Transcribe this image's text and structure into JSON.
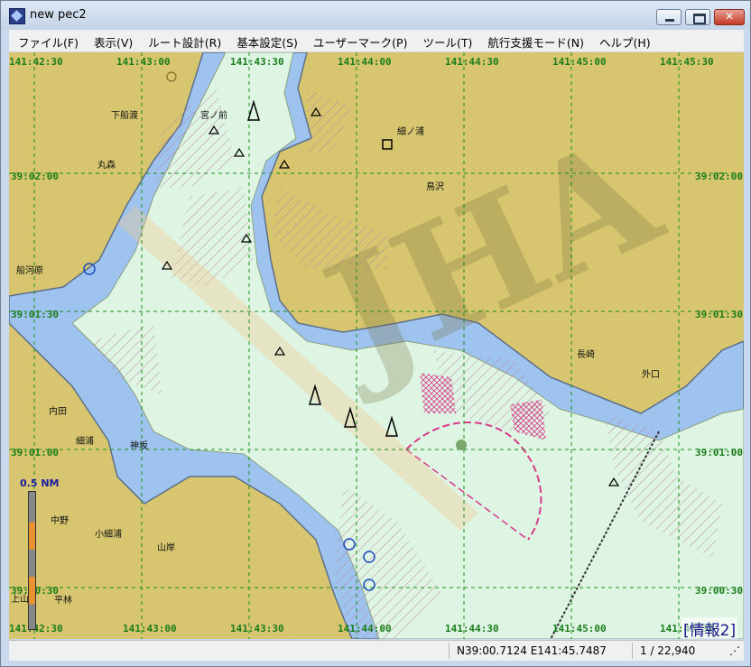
{
  "window": {
    "title": "new pec2"
  },
  "menu": [
    {
      "id": "file",
      "label": "ファイル(F)"
    },
    {
      "id": "view",
      "label": "表示(V)"
    },
    {
      "id": "route",
      "label": "ルート設計(R)"
    },
    {
      "id": "settings",
      "label": "基本設定(S)"
    },
    {
      "id": "usermark",
      "label": "ユーザーマーク(P)"
    },
    {
      "id": "tools",
      "label": "ツール(T)"
    },
    {
      "id": "navmode",
      "label": "航行支援モード(N)"
    },
    {
      "id": "help",
      "label": "ヘルプ(H)"
    }
  ],
  "map": {
    "lon_top": [
      "141:42:30",
      "141:43:00",
      "141:43:30",
      "141:44:00",
      "141:44:30",
      "141:45:00",
      "141:45:30"
    ],
    "lon_bottom": [
      "141:42:30",
      "141:43:00",
      "141:43:30",
      "141:44:00",
      "141:44:30",
      "141:45:00",
      "141:45:30"
    ],
    "lat_left": [
      "39:02:00",
      "39:01:30",
      "39:01:00",
      "39:00:30"
    ],
    "lat_right": [
      "39:02:00",
      "39:01:30",
      "39:01:00",
      "39:00:30"
    ],
    "places": {
      "shimofunawatari": "下船渡",
      "miyanomae": "宮ノ前",
      "hosonoura": "細ノ浦",
      "marumori": "丸森",
      "torisawa": "鳥沢",
      "funakawara": "船河原",
      "nagasaki": "長崎",
      "sotoguchi": "外口",
      "uchida": "内田",
      "hosoura": "細浦",
      "kamisaka": "神坂",
      "nakano": "中野",
      "kohosoura": "小細浦",
      "yamagishi": "山岸",
      "hirabayashi": "平林",
      "kami": "上山"
    },
    "watermark": "JHA",
    "scale_bar_label": "0.5 NM",
    "info_link": "[情報2]"
  },
  "status": {
    "coords": "N39:00.7124 E141:45.7487",
    "scale": "1 / 22,940"
  },
  "colors": {
    "land": "#d7c66f",
    "shallow": "#9ec3ef",
    "deep_water": "#dff5e4",
    "grid": "#1a8f1a",
    "restricted": "#d63a8a"
  }
}
